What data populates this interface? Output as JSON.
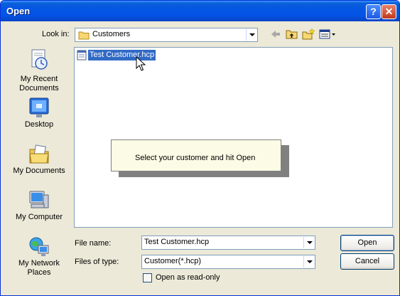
{
  "window": {
    "title": "Open"
  },
  "titlebar_buttons": {
    "help": "?",
    "close": "✕"
  },
  "look_in": {
    "label": "Look in:",
    "value": "Customers"
  },
  "toolbar": {
    "back_icon": "back-arrow-icon",
    "up_icon": "up-folder-icon",
    "new_folder_icon": "new-folder-icon",
    "views_icon": "views-menu-icon"
  },
  "places": [
    {
      "label": "My Recent Documents",
      "icon": "recent-documents-icon"
    },
    {
      "label": "Desktop",
      "icon": "desktop-icon"
    },
    {
      "label": "My Documents",
      "icon": "my-documents-icon"
    },
    {
      "label": "My Computer",
      "icon": "my-computer-icon"
    },
    {
      "label": "My Network Places",
      "icon": "network-places-icon"
    }
  ],
  "files": [
    {
      "name": "Test Customer.hcp",
      "selected": true
    }
  ],
  "tooltip": {
    "text": "Select your customer and hit Open"
  },
  "file_name": {
    "label": "File name:",
    "value": "Test Customer.hcp"
  },
  "file_type": {
    "label": "Files of type:",
    "value": "Customer(*.hcp)"
  },
  "read_only": {
    "label": "Open as read-only",
    "checked": false
  },
  "buttons": {
    "open": "Open",
    "cancel": "Cancel"
  },
  "colors": {
    "titlebar": "#0554e6",
    "selection": "#316ac5",
    "dialog_bg": "#ece9d8",
    "tooltip_bg": "#fbfbe6"
  }
}
